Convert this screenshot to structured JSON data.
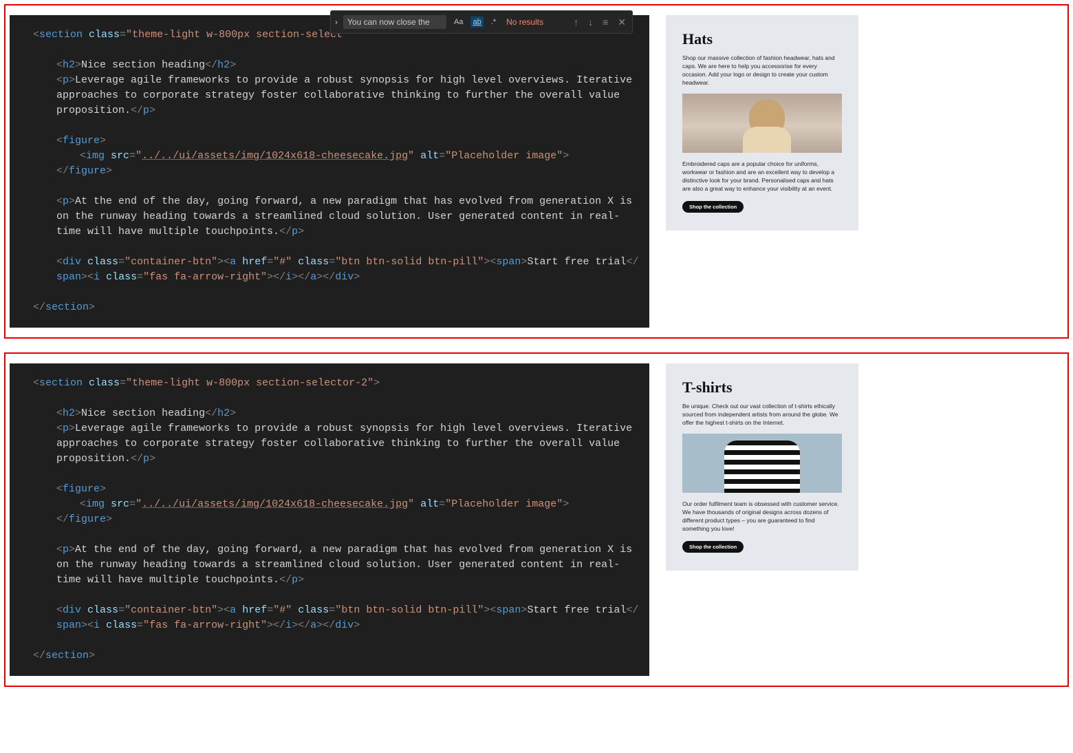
{
  "find_bar": {
    "input_value": "You can now close the",
    "case_label": "Aa",
    "word_label": "ab",
    "regex_label": ".*",
    "results_text": "No results",
    "prev_glyph": "↑",
    "next_glyph": "↓",
    "menu_glyph": "≡",
    "close_glyph": "✕",
    "chevron_glyph": "›"
  },
  "code_common": {
    "tag_section": "section",
    "tag_h2": "h2",
    "tag_p": "p",
    "tag_figure": "figure",
    "tag_img": "img",
    "tag_div": "div",
    "tag_a": "a",
    "tag_span": "span",
    "tag_i": "i",
    "attr_class": "class",
    "attr_src": "src",
    "attr_alt": "alt",
    "attr_href": "href",
    "h2_text": "Nice section heading",
    "p1_text": "Leverage agile frameworks to provide a robust synopsis for high level overviews. Iterative approaches to corporate strategy foster collaborative thinking to further the overall value proposition.",
    "img_src": "../../ui/assets/img/1024x618-cheesecake.jpg",
    "img_alt": "Placeholder image",
    "p2_text": "At the end of the day, going forward, a new paradigm that has evolved from generation X is on the runway heading towards a streamlined cloud solution. User generated content in real-time will have multiple touchpoints.",
    "div_class": "container-btn",
    "a_href": "#",
    "a_class": "btn btn-solid btn-pill",
    "span_text": "Start free trial",
    "i_class": "fas fa-arrow-right"
  },
  "block1": {
    "section_class_visible": "theme-light w-800px section-select"
  },
  "block2": {
    "section_class": "theme-light w-800px section-selector-2"
  },
  "preview1": {
    "title": "Hats",
    "p1": "Shop our massive collection of fashion headwear, hats and caps. We are here to help you accessorise for every occasion. Add your logo or design to create your custom headwear.",
    "p2": "Embroidered caps are a popular choice for uniforms, workwear or fashion and are an excellent way to develop a distinctive look for your brand. Personalised caps and hats are also a great way to enhance your visibility at an event.",
    "button": "Shop the collection"
  },
  "preview2": {
    "title": "T-shirts",
    "p1": "Be unique. Check out our vast collection of t-shirts ethically sourced from independent artists from around the globe. We offer the highest t-shirts on the Internet.",
    "p2": "Our order fulfilment team is obsessed with customer service. We have thousands of original designs across dozens of different product types – you are guaranteed to find something you love!",
    "button": "Shop the collection"
  }
}
